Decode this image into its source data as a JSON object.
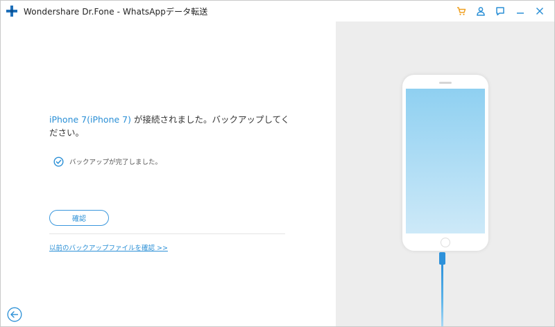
{
  "window": {
    "title": "Wondershare Dr.Fone - WhatsAppデータ転送",
    "logo_icon": "plus-cross-logo",
    "accent_color": "#2a8fd6",
    "cart_color": "#f0a020"
  },
  "titlebar": {
    "buttons": [
      {
        "name": "cart-icon"
      },
      {
        "name": "user-icon"
      },
      {
        "name": "feedback-icon"
      },
      {
        "name": "minimize-icon"
      },
      {
        "name": "close-icon"
      }
    ]
  },
  "main": {
    "device_name": "iPhone 7(iPhone 7)",
    "status_message": "が接続されました。バックアップしてください。",
    "backup_done": "バックアップが完了しました。",
    "confirm_button": "確認",
    "previous_backup_link": "以前のバックアップファイルを確認 >>"
  },
  "footer": {
    "back_icon": "arrow-left-circle-icon"
  },
  "illustration": {
    "phone": "iphone-illustration",
    "cable": "usb-cable",
    "screen_color": "#8fd0f1",
    "cable_color": "#2d91da"
  }
}
